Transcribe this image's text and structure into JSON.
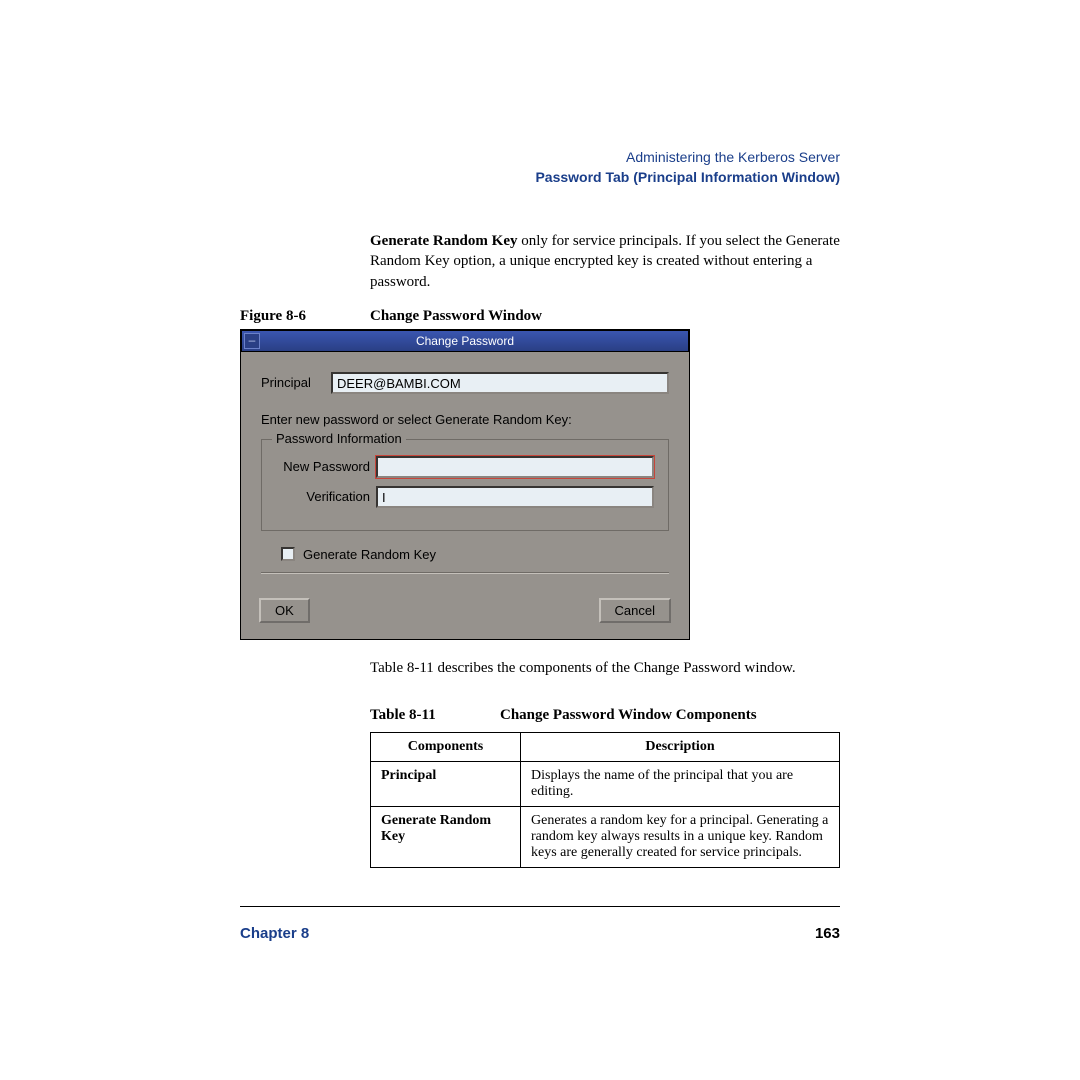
{
  "header": {
    "breadcrumb": "Administering the Kerberos Server",
    "section": "Password Tab (Principal Information Window)"
  },
  "body": {
    "para1_bold": "Generate Random Key",
    "para1_rest": " only for service principals. If you select the Generate Random Key option, a unique encrypted key is created without entering a password."
  },
  "figure": {
    "num": "Figure 8-6",
    "title": "Change Password Window"
  },
  "window": {
    "title": "Change Password",
    "principal_label": "Principal",
    "principal_value": "DEER@BAMBI.COM",
    "prompt": "Enter new password or select Generate Random Key:",
    "group_legend": "Password Information",
    "newpw_label": "New Password",
    "verify_label": "Verification",
    "verify_value": "I",
    "checkbox_label": "Generate Random Key",
    "ok": "OK",
    "cancel": "Cancel"
  },
  "after_para": "Table 8-11 describes the components of the Change Password window.",
  "table": {
    "num": "Table 8-11",
    "title": "Change Password Window Components",
    "head_c1": "Components",
    "head_c2": "Description",
    "rows": [
      {
        "c1": "Principal",
        "c2": "Displays the name of the principal that you are editing."
      },
      {
        "c1": "Generate Random Key",
        "c2": "Generates a random key for a principal. Generating a random key always results in a unique key. Random keys are generally created for service principals."
      }
    ]
  },
  "footer": {
    "chapter": "Chapter 8",
    "page": "163"
  }
}
